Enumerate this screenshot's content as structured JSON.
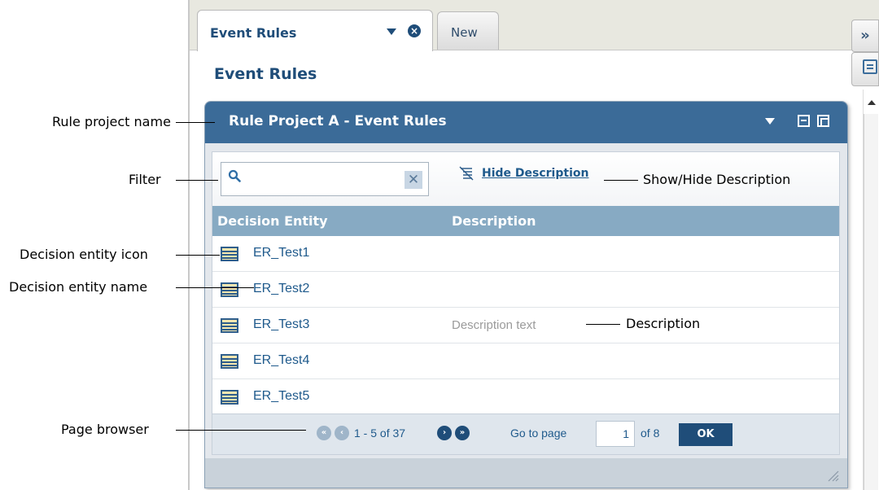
{
  "tabs": {
    "active_label": "Event Rules",
    "inactive_label": "New"
  },
  "side_buttons": {
    "expand_glyph": "»"
  },
  "page": {
    "heading": "Event Rules"
  },
  "panel": {
    "title": "Rule Project A - Event Rules"
  },
  "toolbar": {
    "filter_value": "",
    "clear_glyph": "✕",
    "toggle_description_label": "Hide Description"
  },
  "table": {
    "columns": [
      "Decision Entity",
      "Description"
    ],
    "rows": [
      {
        "name": "ER_Test1",
        "description": ""
      },
      {
        "name": "ER_Test2",
        "description": ""
      },
      {
        "name": "ER_Test3",
        "description": "Description text"
      },
      {
        "name": "ER_Test4",
        "description": ""
      },
      {
        "name": "ER_Test5",
        "description": ""
      }
    ]
  },
  "pager": {
    "range_text": "1 - 5 of 37",
    "goto_label": "Go to page",
    "page_value": "1",
    "of_pages": "of 8",
    "ok_label": "OK",
    "first_glyph": "«",
    "prev_glyph": "‹",
    "next_glyph": "›",
    "last_glyph": "»"
  },
  "callouts": {
    "rule_project_name": "Rule project name",
    "filter": "Filter",
    "decision_entity_icon": "Decision entity icon",
    "decision_entity_name": "Decision entity name",
    "page_browser": "Page browser",
    "show_hide_description": "Show/Hide Description",
    "description": "Description"
  },
  "colors": {
    "header_blue": "#3b6b98",
    "column_header": "#87aac3",
    "link_blue": "#1f5a8c",
    "dark_blue": "#1f4d79"
  },
  "icons": {
    "tab_menu": "chevron-down-icon",
    "tab_close": "close-circle-icon",
    "search": "search-icon",
    "clear": "clear-icon",
    "toggle_description": "description-toggle-icon",
    "entity": "decision-entity-icon",
    "minimize": "minimize-icon",
    "maximize": "maximize-icon",
    "resize": "resize-grip-icon"
  }
}
